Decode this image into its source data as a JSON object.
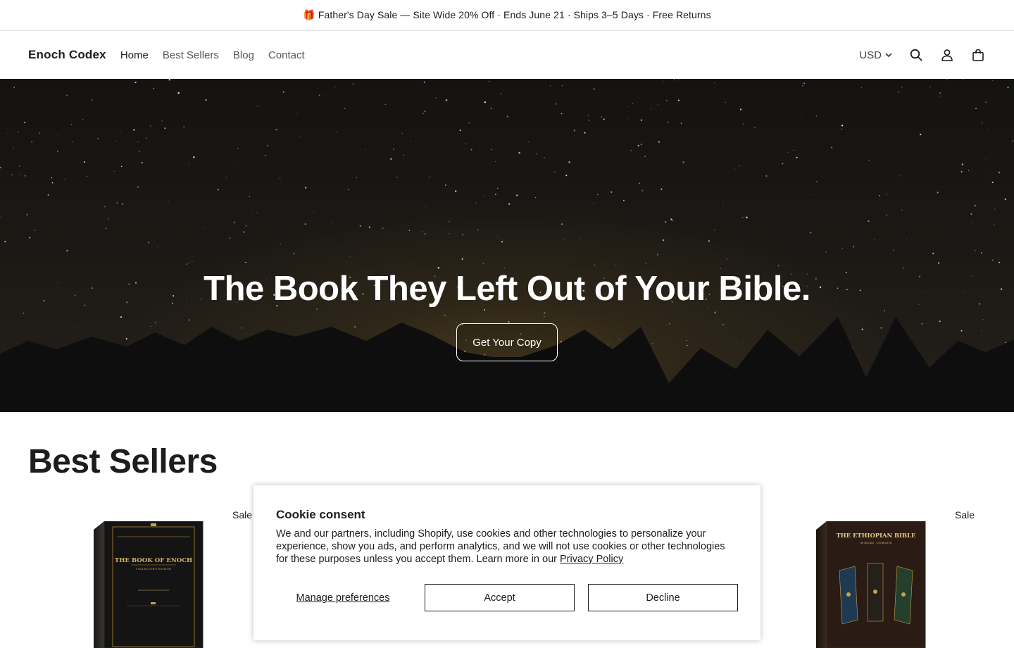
{
  "announcement": {
    "text": "🎁 Father's Day Sale — Site Wide 20% Off · Ends June 21 · Ships 3–5 Days · Free Returns"
  },
  "header": {
    "brand": "Enoch Codex",
    "nav": [
      {
        "label": "Home"
      },
      {
        "label": "Best Sellers"
      },
      {
        "label": "Blog"
      },
      {
        "label": "Contact"
      }
    ],
    "currency": "USD",
    "icons": [
      "search-icon",
      "account-icon",
      "cart-icon"
    ]
  },
  "hero": {
    "title": "The Book They Left Out of Your Bible.",
    "cta": "Get Your Copy"
  },
  "best_sellers": {
    "title": "Best Sellers",
    "products": [
      {
        "badge": "Sale",
        "cover_title": "THE BOOK OF ENOCH",
        "cover_subtitle": "COLLECTOR'S EDITION"
      },
      {
        "badge": "Sale",
        "cover_title": "THE ETHIOPIAN BIBLE",
        "cover_subtitle": "88 BOOKS · COMPLETE"
      }
    ]
  },
  "cookie": {
    "title": "Cookie consent",
    "body": "We and our partners, including Shopify, use cookies and other technologies to personalize your experience, show you ads, and perform analytics, and we will not use cookies or other technologies for these purposes unless you accept them. Learn more in our ",
    "link": "Privacy Policy",
    "manage": "Manage preferences",
    "accept": "Accept",
    "decline": "Decline"
  },
  "colors": {
    "hero_dark": "#141312",
    "hero_glow": "#4a3d22",
    "gold": "#c9a24a",
    "text": "#1d1d1f"
  }
}
